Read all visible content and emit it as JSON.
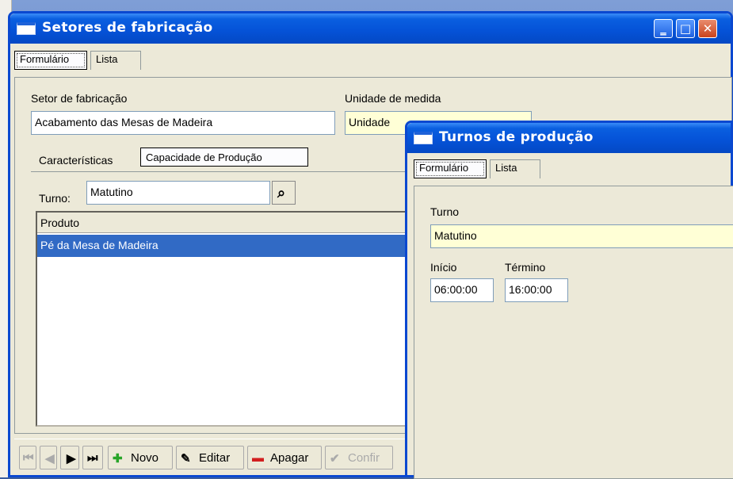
{
  "main_window": {
    "title": "Setores de fabricação",
    "tabs": [
      "Formulário",
      "Lista"
    ],
    "setor_label": "Setor de fabricação",
    "setor_value": "Acabamento das Mesas de Madeira",
    "unidade_label": "Unidade de medida",
    "unidade_value": "Unidade",
    "inner_tabs": [
      "Características",
      "Capacidade de Produção"
    ],
    "turno_label": "Turno:",
    "turno_value": "Matutino",
    "grid": {
      "header": "Produto",
      "rows": [
        "Pé da Mesa de Madeira"
      ]
    },
    "toolbar": {
      "novo": "Novo",
      "editar": "Editar",
      "apagar": "Apagar",
      "confirmar": "Confir"
    }
  },
  "turnos_window": {
    "title": "Turnos de produção",
    "tabs": [
      "Formulário",
      "Lista"
    ],
    "turno_label": "Turno",
    "turno_value": "Matutino",
    "inicio_label": "Início",
    "inicio_value": "06:00:00",
    "termino_label": "Término",
    "termino_value": "16:00:00"
  },
  "colors": {
    "titlebar": "#0553d8",
    "selection": "#316ac5",
    "required_field": "#ffffd6",
    "close_button": "#c9431d"
  },
  "icons": [
    "window-icon",
    "minimize-icon",
    "maximize-icon",
    "close-icon",
    "search-icon",
    "first-icon",
    "prev-icon",
    "next-icon",
    "last-icon",
    "add-icon",
    "edit-icon",
    "delete-icon",
    "check-icon"
  ]
}
